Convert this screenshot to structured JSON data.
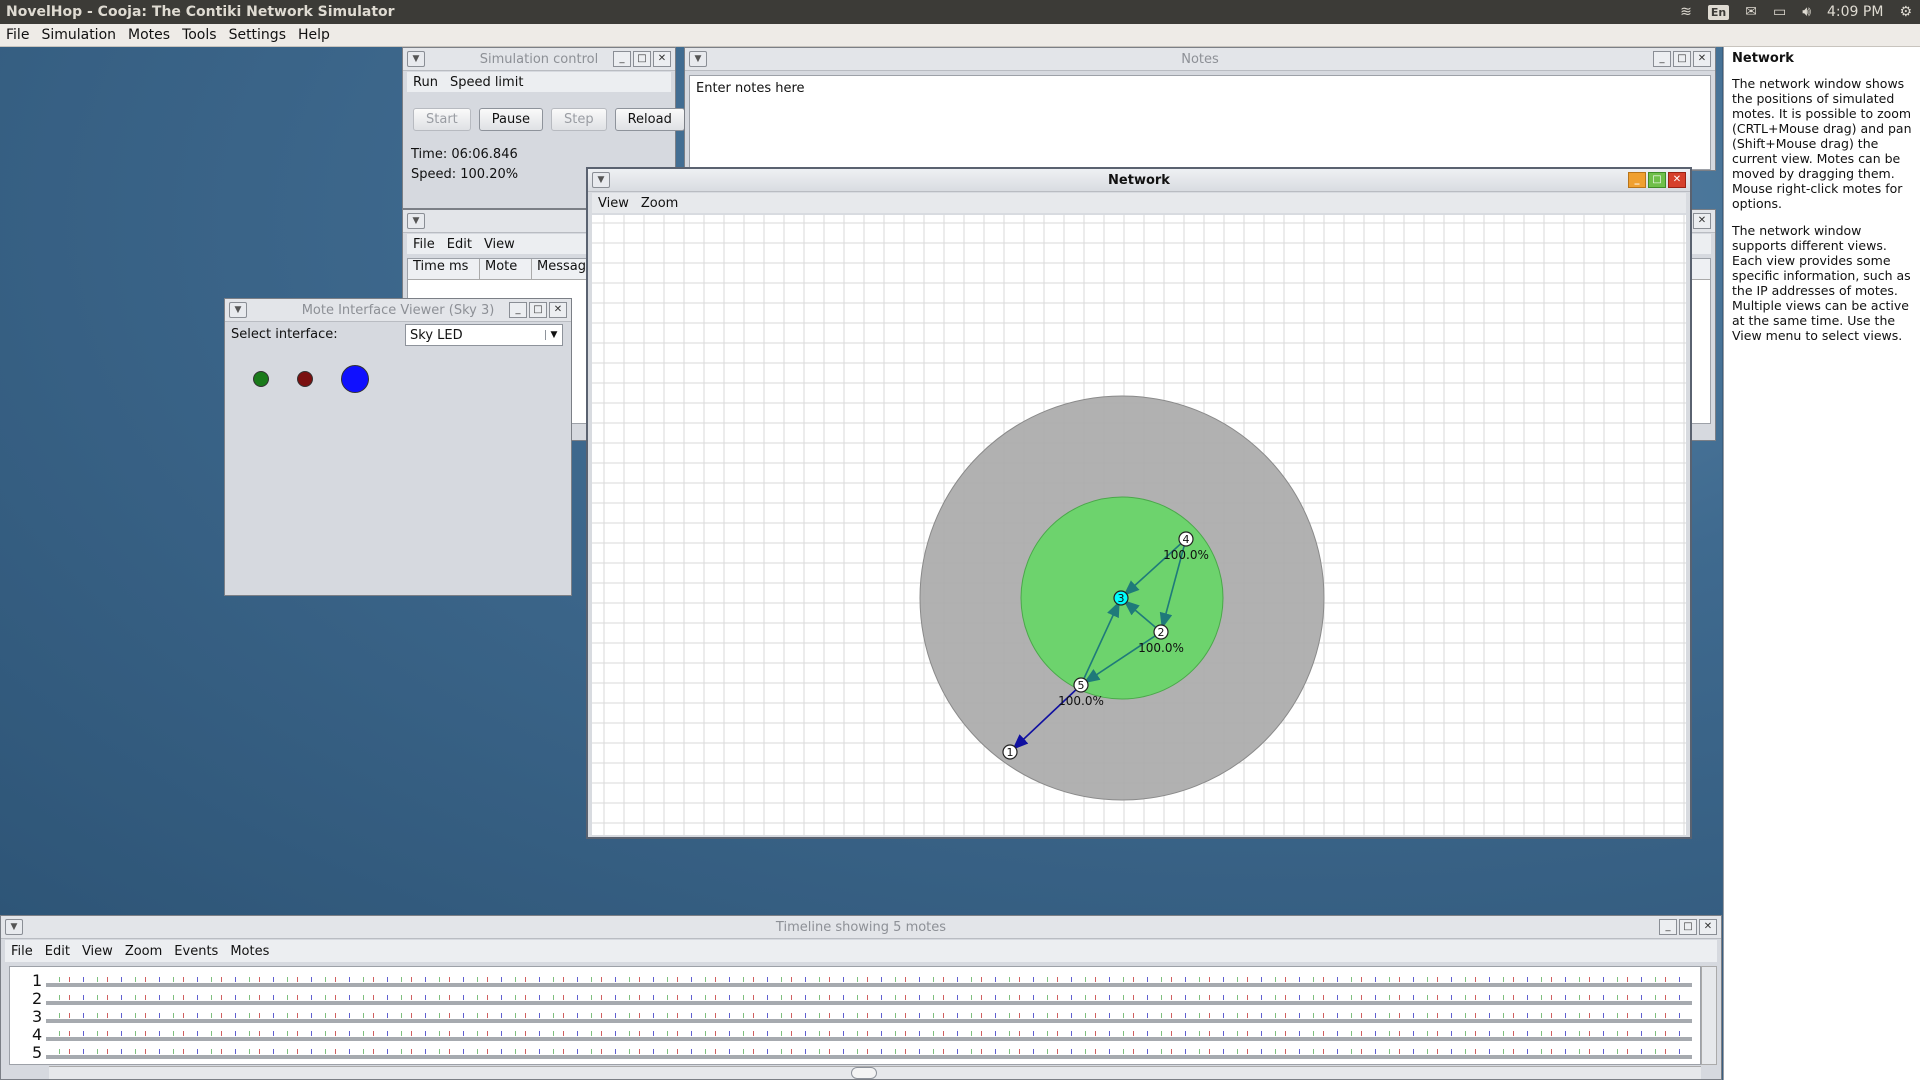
{
  "topbar": {
    "title": "NovelHop - Cooja: The Contiki Network Simulator",
    "lang": "En",
    "time": "4:09 PM",
    "icons": [
      "wifi-icon",
      "mail-icon",
      "battery-icon",
      "volume-icon",
      "gear-icon"
    ]
  },
  "menubar": [
    "File",
    "Simulation",
    "Motes",
    "Tools",
    "Settings",
    "Help"
  ],
  "simcontrol": {
    "title": "Simulation control",
    "menu": [
      "Run",
      "Speed limit"
    ],
    "buttons": [
      "Start",
      "Pause",
      "Step",
      "Reload"
    ],
    "time": "Time: 06:06.846",
    "speed": "Speed: 100.20%"
  },
  "notes": {
    "title": "Notes",
    "text": "Enter notes here"
  },
  "log": {
    "menu": [
      "File",
      "Edit",
      "View"
    ],
    "columns": [
      "Time ms",
      "Mote",
      "Message"
    ]
  },
  "moteviewer": {
    "title": "Mote Interface Viewer (Sky 3)",
    "label": "Select interface:",
    "selected": "Sky LED",
    "leds": [
      {
        "color": "#1a7a1a",
        "size": "small"
      },
      {
        "color": "#7a1010",
        "size": "small"
      },
      {
        "color": "#1010ff",
        "size": "large"
      }
    ]
  },
  "network": {
    "title": "Network",
    "menu": [
      "View",
      "Zoom"
    ],
    "motes": [
      {
        "id": "1",
        "label": ""
      },
      {
        "id": "2",
        "label": "100.0%"
      },
      {
        "id": "3",
        "label": ""
      },
      {
        "id": "4",
        "label": "100.0%"
      },
      {
        "id": "5",
        "label": "100.0%"
      }
    ],
    "colors": {
      "range": "#a9a9a9",
      "interference": "#6dd36d",
      "selected": "#00ffff",
      "arrow": "#1f7a7a",
      "arrow_blue": "#1010a0"
    }
  },
  "timeline": {
    "title": "Timeline showing 5 motes",
    "menu": [
      "File",
      "Edit",
      "View",
      "Zoom",
      "Events",
      "Motes"
    ],
    "rows": [
      "1",
      "2",
      "3",
      "4",
      "5"
    ]
  },
  "help": {
    "title": "Network",
    "p1": "The network window shows the positions of simulated motes. It is possible to zoom (CRTL+Mouse drag) and pan (Shift+Mouse drag) the current view. Motes can be moved by dragging them. Mouse right-click motes for options.",
    "p2": "The network window supports different views. Each view provides some specific information, such as the IP addresses of motes. Multiple views can be active at the same time. Use the View menu to select views."
  }
}
